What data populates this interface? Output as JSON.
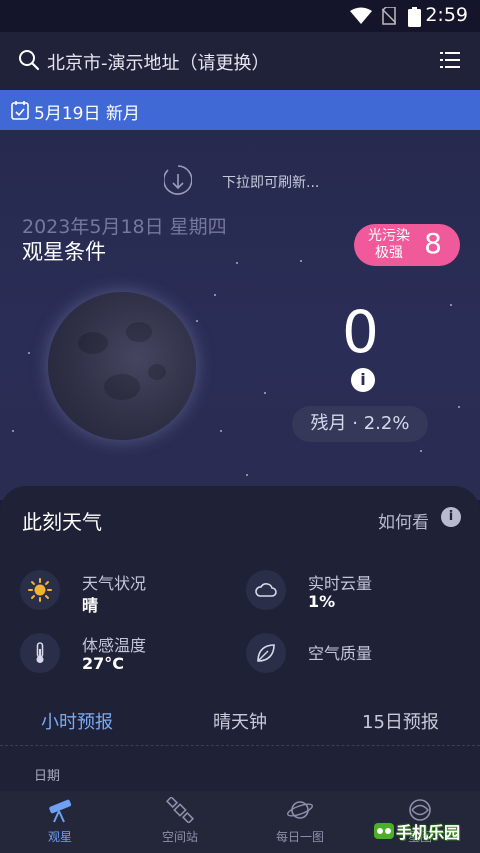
{
  "status_bar": {
    "time": "2:59"
  },
  "search": {
    "location": "北京市-演示地址（请更换）"
  },
  "notice": {
    "text": "5月19日 新月"
  },
  "refresh": {
    "hint": "下拉即可刷新..."
  },
  "conditions": {
    "date": "2023年5月18日 星期四",
    "title": "观星条件",
    "light_pollution_label": "光污染\n极强",
    "light_pollution_value": "8",
    "score": "0",
    "moon_phase": "残月 · 2.2%"
  },
  "weather": {
    "title": "此刻天气",
    "how_to_read": "如何看",
    "items": [
      {
        "label": "天气状况",
        "value": "晴",
        "icon": "sun-icon"
      },
      {
        "label": "实时云量",
        "value": "1%",
        "icon": "cloud-icon"
      },
      {
        "label": "体感温度",
        "value": "27°C",
        "icon": "thermometer-icon"
      },
      {
        "label": "空气质量",
        "value": "",
        "icon": "leaf-icon"
      }
    ],
    "tabs": [
      "小时预报",
      "晴天钟",
      "15日预报"
    ],
    "active_tab": "小时预报",
    "date_label": "日期"
  },
  "nav": {
    "items": [
      "观星",
      "空间站",
      "每日一图",
      "星图"
    ],
    "active": "观星"
  },
  "watermark": {
    "text": "手机乐园"
  },
  "colors": {
    "accent": "#79aaf6",
    "notice_bar": "#4169d6",
    "pollution_badge": "#f15a9a",
    "sun": "#f2b233"
  }
}
